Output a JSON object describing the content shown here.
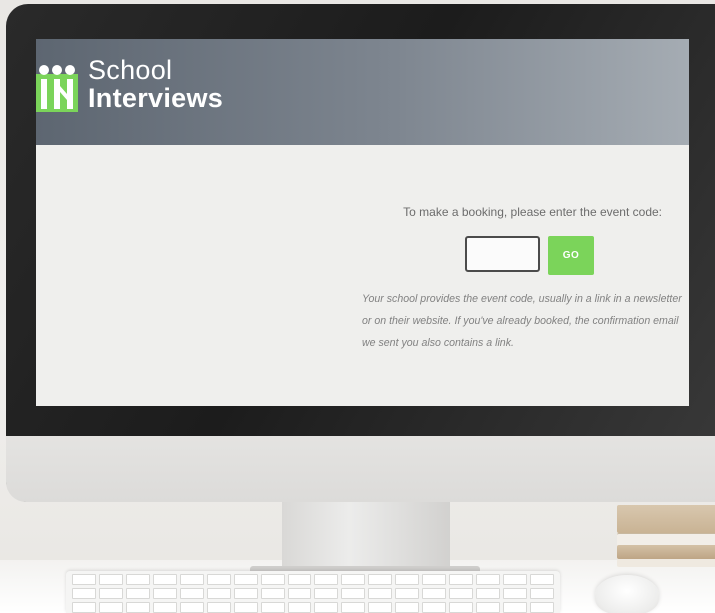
{
  "brand": {
    "line1": "School",
    "line2": "Interviews",
    "logo_icon": "school-interviews-logo-icon",
    "colors": {
      "logo_green": "#7bd45a",
      "header_gray": "#6b737d",
      "go_button": "#7bd45a"
    }
  },
  "booking": {
    "prompt": "To make a booking, please enter the event code:",
    "code_input_value": "",
    "go_label": "GO",
    "help_text": "Your school provides the event code, usually in a link in a newsletter or on their website. If you've already booked, the confirmation email we sent you also contains a link."
  }
}
